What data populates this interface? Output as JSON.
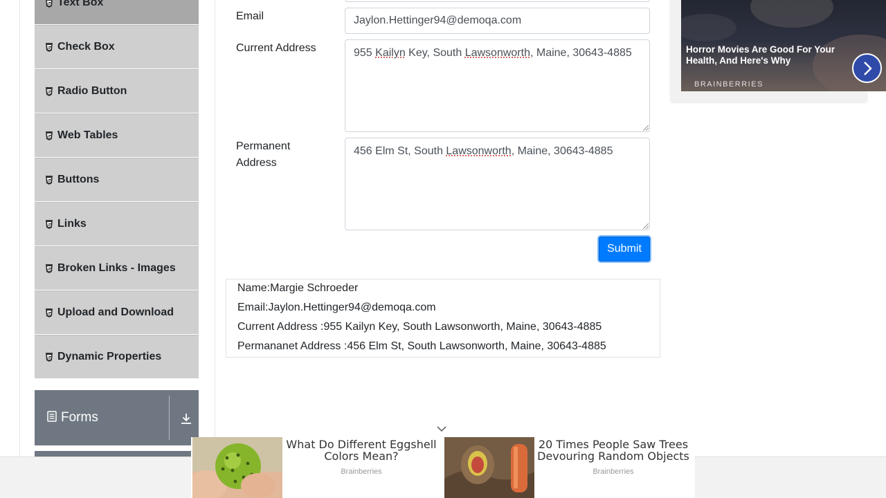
{
  "sidebar": {
    "items": [
      {
        "label": "Text Box",
        "active": true
      },
      {
        "label": "Check Box"
      },
      {
        "label": "Radio Button"
      },
      {
        "label": "Web Tables"
      },
      {
        "label": "Buttons"
      },
      {
        "label": "Links"
      },
      {
        "label": "Broken Links - Images"
      },
      {
        "label": "Upload and Download"
      },
      {
        "label": "Dynamic Properties"
      }
    ],
    "group": {
      "label": "Forms",
      "icon": "document-icon",
      "action_icon": "download-icon"
    }
  },
  "form": {
    "email_label": "Email",
    "email_value": "Jaylon.Hettinger94@demoqa.com",
    "current_address_label": "Current Address",
    "current_address_parts": [
      "955 ",
      "Kailyn",
      " Key, South ",
      "Lawsonworth",
      ", Maine, 30643-4885"
    ],
    "permanent_address_label": "Permanent Address",
    "permanent_address_parts": [
      "456 Elm St, South ",
      "Lawsonworth",
      ", Maine, 30643-4885"
    ],
    "submit_label": "Submit"
  },
  "output": {
    "name": "Name:Margie Schroeder",
    "email": "Email:Jaylon.Hettinger94@demoqa.com",
    "current_address": "Current Address :955 Kailyn Key, South Lawsonworth, Maine, 30643-4885",
    "permanent_address": "Permananet Address :456 Elm St, South Lawsonworth, Maine, 30643-4885"
  },
  "side_ad": {
    "headline": "Horror Movies Are Good For Your Health, And Here's Why",
    "brand": "BRAINBERRIES",
    "next_icon": "chevron-right-icon"
  },
  "bottom_ads": [
    {
      "title": "What Do Different Eggshell Colors Mean?",
      "source": "Brainberries"
    },
    {
      "title": "20 Times People Saw Trees Devouring Random Objects",
      "source": "Brainberries"
    }
  ],
  "colors": {
    "primary": "#007bff",
    "sidebar_item": "#cfcfcf",
    "sidebar_active": "#a8a8a8",
    "group_header": "#6f7882"
  }
}
